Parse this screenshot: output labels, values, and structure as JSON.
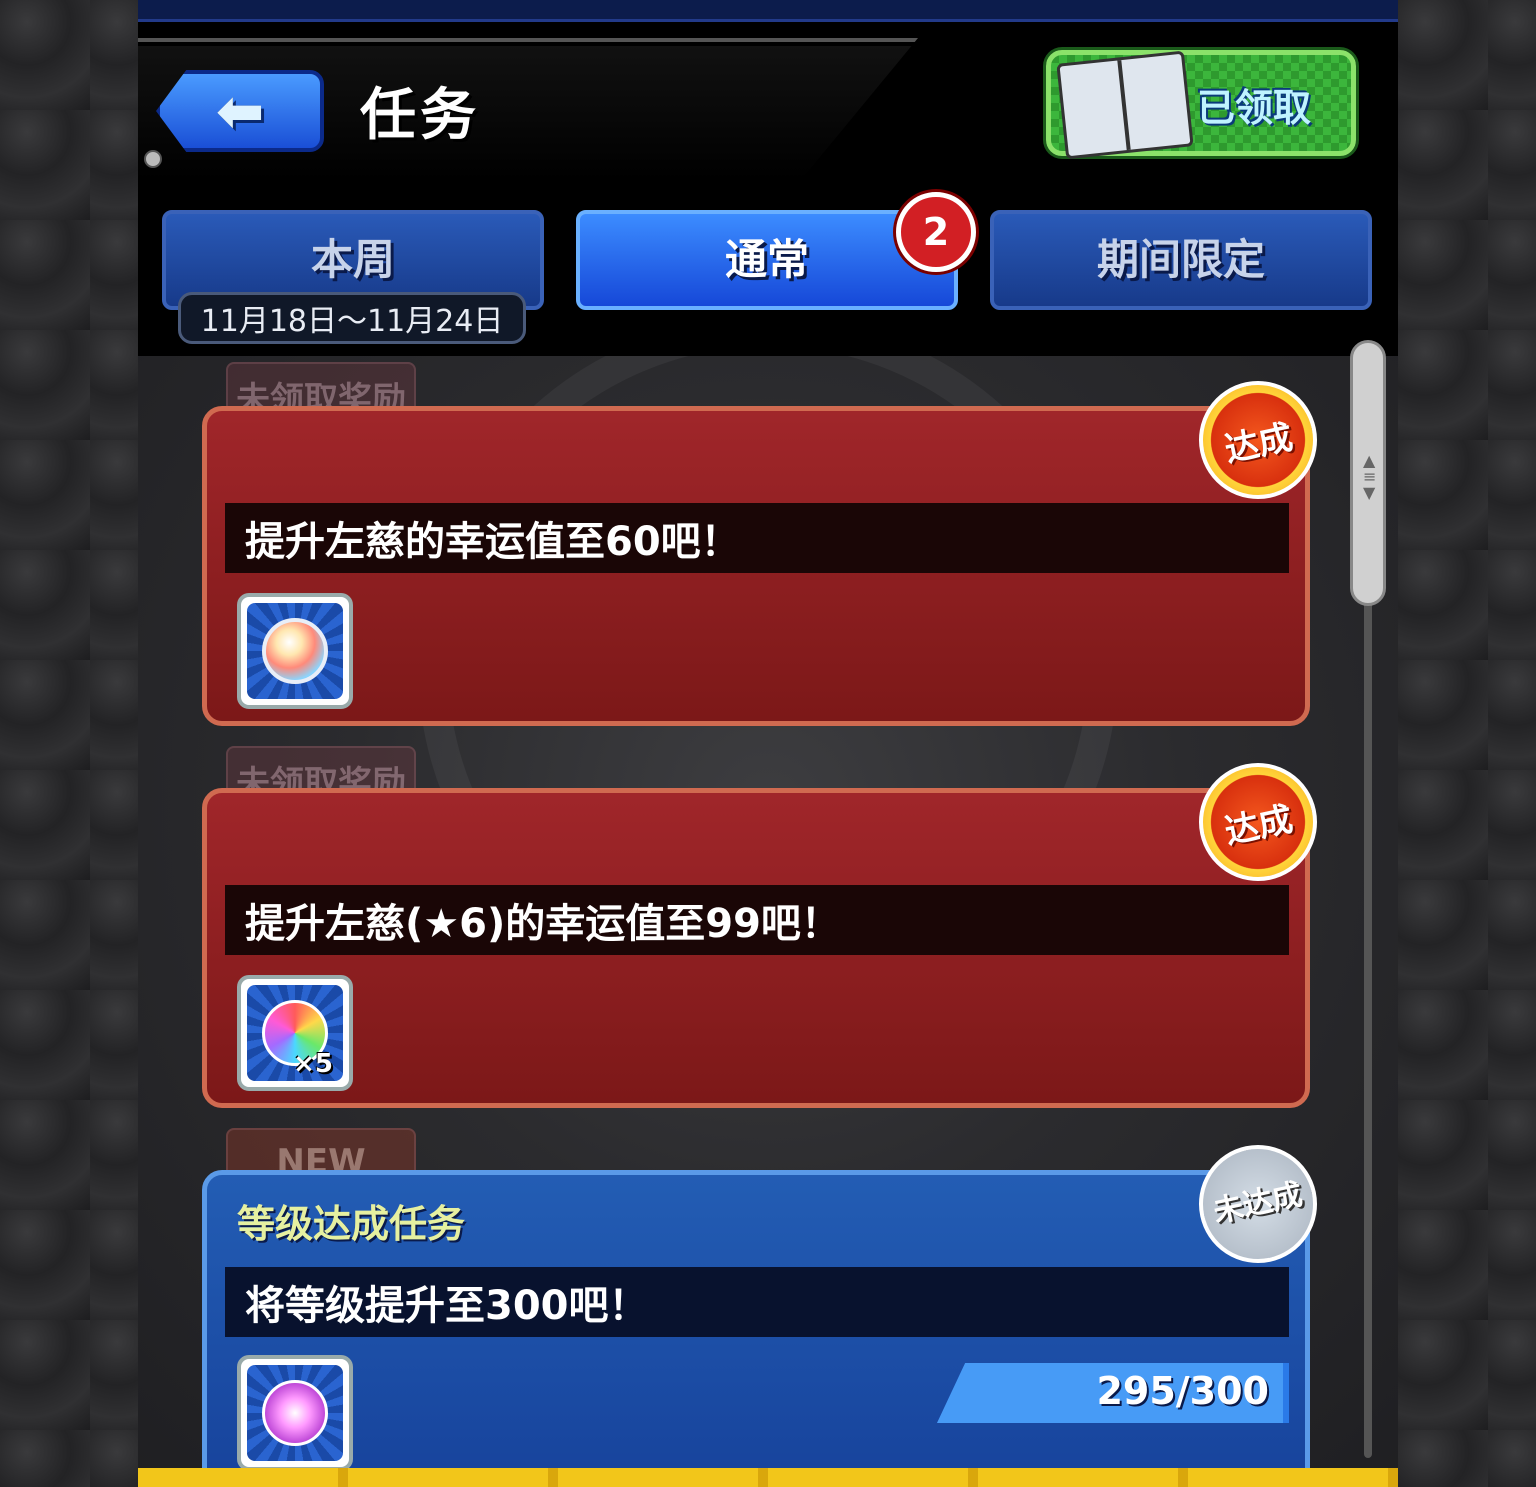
{
  "header": {
    "title": "任务",
    "book_button_label": "已领取"
  },
  "tabs": {
    "weekly": "本周",
    "weekly_dates": "11月18日～11月24日",
    "normal": "通常",
    "normal_badge": "2",
    "limited": "期间限定"
  },
  "missions": [
    {
      "tag": "未领取奖励",
      "text": "提升左慈的幸运值至60吧！",
      "status": "达成",
      "reward_icon": "luck-orb-icon",
      "reward_qty": ""
    },
    {
      "tag": "未领取奖励",
      "text": "提升左慈(★6)的幸运值至99吧！",
      "status": "达成",
      "reward_icon": "rainbow-orb-icon",
      "reward_qty": "×5"
    },
    {
      "tag": "NEW",
      "category": "等级达成任务",
      "text": "将等级提升至300吧！",
      "status": "未达成",
      "reward_icon": "star-orb-icon",
      "progress_current": 295,
      "progress_total": 300,
      "progress_text": "295/300"
    }
  ],
  "colors": {
    "completed_card": "#8e1e20",
    "active_card": "#1d4fa8",
    "accent_blue": "#1648d8",
    "badge_red": "#d21f24",
    "green_button": "#3cb63c"
  }
}
